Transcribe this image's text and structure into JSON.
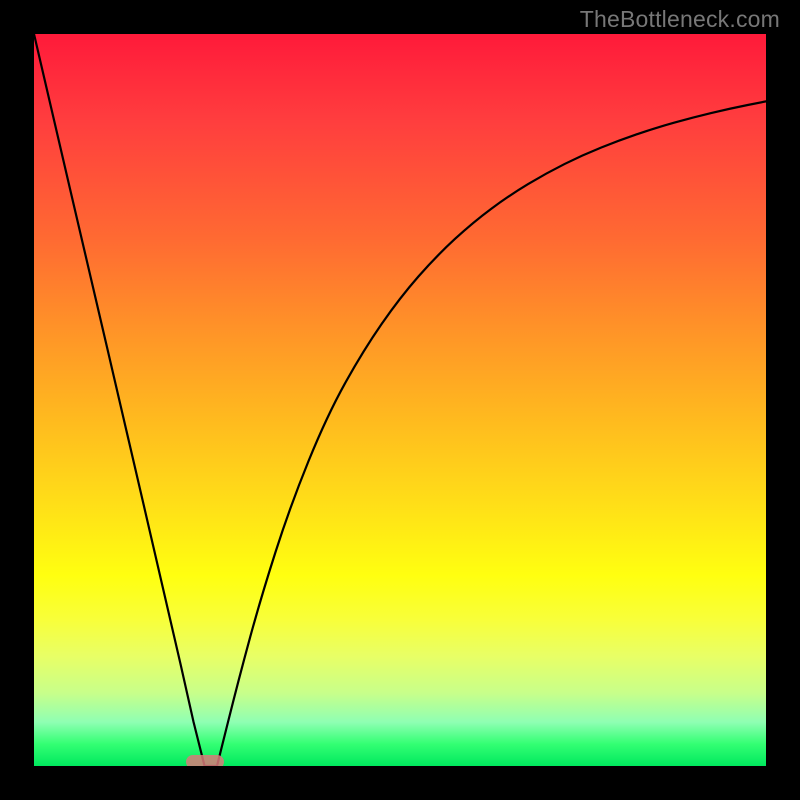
{
  "watermark": "TheBottleneck.com",
  "marker": {
    "color": "#d97a7a",
    "x_frac": 0.233,
    "y_frac": 0.994
  },
  "chart_data": {
    "type": "line",
    "title": "",
    "xlabel": "",
    "ylabel": "",
    "xlim": [
      0,
      1
    ],
    "ylim": [
      0,
      1
    ],
    "background_gradient": {
      "direction": "vertical",
      "stops": [
        {
          "pos": 0.0,
          "color": "#ff1a3a"
        },
        {
          "pos": 0.5,
          "color": "#ffb81f"
        },
        {
          "pos": 0.8,
          "color": "#ffff10"
        },
        {
          "pos": 1.0,
          "color": "#00e85e"
        }
      ]
    },
    "series": [
      {
        "name": "left-branch",
        "x": [
          0.0,
          0.05,
          0.1,
          0.15,
          0.2,
          0.218,
          0.233
        ],
        "y": [
          1.0,
          0.785,
          0.571,
          0.356,
          0.14,
          0.06,
          0.0
        ]
      },
      {
        "name": "right-branch",
        "x": [
          0.25,
          0.28,
          0.31,
          0.35,
          0.4,
          0.45,
          0.5,
          0.55,
          0.6,
          0.65,
          0.7,
          0.75,
          0.8,
          0.85,
          0.9,
          0.95,
          1.0
        ],
        "y": [
          0.0,
          0.12,
          0.23,
          0.355,
          0.478,
          0.568,
          0.64,
          0.697,
          0.743,
          0.78,
          0.81,
          0.835,
          0.855,
          0.872,
          0.886,
          0.898,
          0.908
        ]
      }
    ],
    "marker_point": {
      "x": 0.233,
      "y": 0.006
    }
  }
}
